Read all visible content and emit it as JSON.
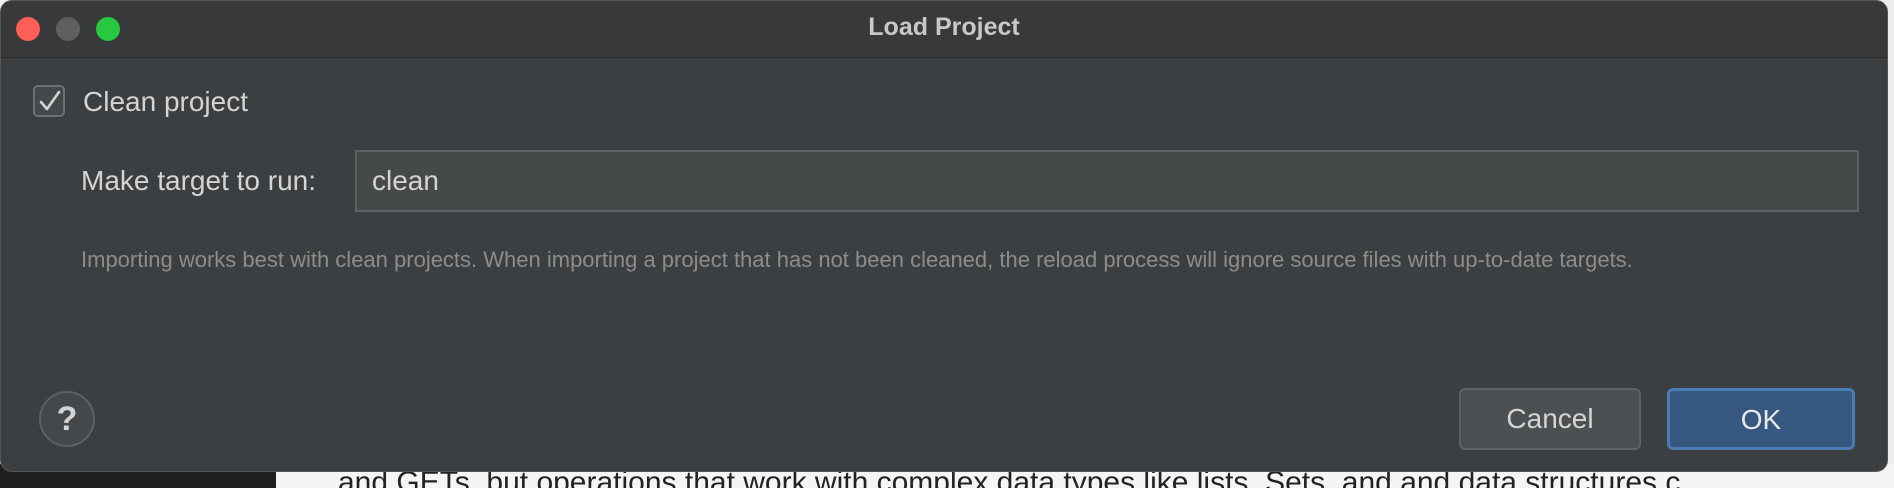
{
  "window": {
    "title": "Load Project"
  },
  "options": {
    "clean_project": {
      "label": "Clean project",
      "checked": true
    },
    "make_target": {
      "label": "Make target to run:",
      "value": "clean"
    },
    "hint": "Importing works best with clean projects. When importing a project that has not been cleaned, the reload process will ignore source files with up-to-date targets."
  },
  "buttons": {
    "help_icon": "question-mark-icon",
    "help_glyph": "?",
    "cancel_label": "Cancel",
    "ok_label": "OK"
  },
  "colors": {
    "dialog_bg": "#3c3f41",
    "primary_button": "#365880",
    "close_traffic_light": "#fe5f57",
    "zoom_traffic_light": "#28c840"
  },
  "background": {
    "partial_text": "and GETs, but operations that work with complex data types like lists, Sets, and and data structures c"
  }
}
